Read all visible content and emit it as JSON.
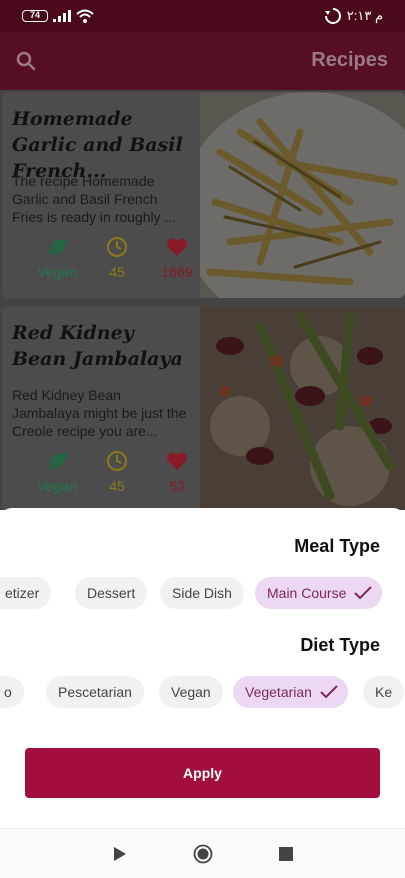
{
  "status_bar": {
    "battery": "74",
    "time": "۲:۱۳ م"
  },
  "app_bar": {
    "title": "Recipes"
  },
  "recipes": [
    {
      "title": "Homemade Garlic and Basil French...",
      "description": "The recipe Homemade Garlic and Basil French Fries is ready in roughly ...",
      "diet_label": "Vegan",
      "minutes": "45",
      "likes": "1669"
    },
    {
      "title": "Red Kidney Bean Jambalaya",
      "description": "Red Kidney Bean Jambalaya might be just the Creole recipe you are...",
      "diet_label": "Vegan",
      "minutes": "45",
      "likes": "53"
    }
  ],
  "sheet": {
    "meal_type_title": "Meal Type",
    "meal_types": [
      "etizer",
      "Dessert",
      "Side Dish",
      "Main Course"
    ],
    "meal_selected": "Main Course",
    "diet_type_title": "Diet Type",
    "diet_types": [
      "o",
      "Pescetarian",
      "Vegan",
      "Vegetarian",
      "Ke"
    ],
    "diet_selected": "Vegetarian",
    "apply_label": "Apply"
  },
  "colors": {
    "primary": "#a30f3c",
    "chip_selected": "#ecd8f2",
    "vegan": "#1f7a4a",
    "time": "#8a7a1a",
    "heart": "#8a1a2a"
  }
}
